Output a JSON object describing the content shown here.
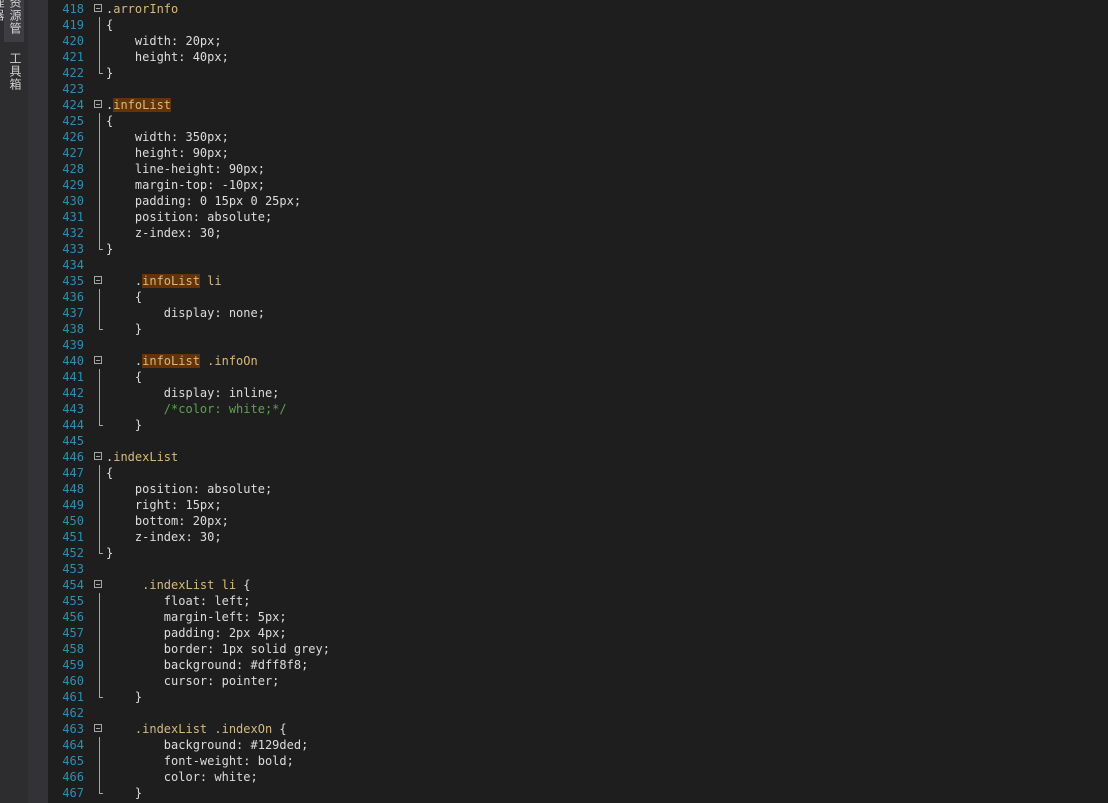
{
  "side_tabs": [
    "资源管理器",
    "工具箱"
  ],
  "lines": [
    {
      "n": "418",
      "fold": "start",
      "tokens": [
        {
          "t": ".",
          "c": "punc"
        },
        {
          "t": "arrorInfo",
          "c": "sel"
        }
      ]
    },
    {
      "n": "419",
      "fold": "mid",
      "tokens": [
        {
          "t": "{",
          "c": "punc"
        }
      ]
    },
    {
      "n": "420",
      "fold": "mid",
      "tokens": [
        {
          "t": "    width",
          "c": "prop"
        },
        {
          "t": ": 20px;",
          "c": "val"
        }
      ]
    },
    {
      "n": "421",
      "fold": "mid",
      "tokens": [
        {
          "t": "    height",
          "c": "prop"
        },
        {
          "t": ": 40px;",
          "c": "val"
        }
      ]
    },
    {
      "n": "422",
      "fold": "end",
      "tokens": [
        {
          "t": "}",
          "c": "punc"
        }
      ]
    },
    {
      "n": "423",
      "fold": "none",
      "tokens": []
    },
    {
      "n": "424",
      "fold": "start",
      "tokens": [
        {
          "t": ".",
          "c": "punc"
        },
        {
          "t": "infoList",
          "c": "sel-hl"
        }
      ]
    },
    {
      "n": "425",
      "fold": "mid",
      "tokens": [
        {
          "t": "{",
          "c": "punc"
        }
      ]
    },
    {
      "n": "426",
      "fold": "mid",
      "tokens": [
        {
          "t": "    width",
          "c": "prop"
        },
        {
          "t": ": 350px;",
          "c": "val"
        }
      ]
    },
    {
      "n": "427",
      "fold": "mid",
      "tokens": [
        {
          "t": "    height",
          "c": "prop"
        },
        {
          "t": ": 90px;",
          "c": "val"
        }
      ]
    },
    {
      "n": "428",
      "fold": "mid",
      "tokens": [
        {
          "t": "    line-height",
          "c": "prop"
        },
        {
          "t": ": 90px;",
          "c": "val"
        }
      ]
    },
    {
      "n": "429",
      "fold": "mid",
      "tokens": [
        {
          "t": "    margin-top",
          "c": "prop"
        },
        {
          "t": ": -10px;",
          "c": "val"
        }
      ]
    },
    {
      "n": "430",
      "fold": "mid",
      "tokens": [
        {
          "t": "    padding",
          "c": "prop"
        },
        {
          "t": ": 0 15px 0 25px;",
          "c": "val"
        }
      ]
    },
    {
      "n": "431",
      "fold": "mid",
      "tokens": [
        {
          "t": "    position",
          "c": "prop"
        },
        {
          "t": ": absolute;",
          "c": "val"
        }
      ]
    },
    {
      "n": "432",
      "fold": "mid",
      "tokens": [
        {
          "t": "    z-index",
          "c": "prop"
        },
        {
          "t": ": 30;",
          "c": "val"
        }
      ]
    },
    {
      "n": "433",
      "fold": "end",
      "tokens": [
        {
          "t": "}",
          "c": "punc"
        }
      ]
    },
    {
      "n": "434",
      "fold": "none",
      "tokens": []
    },
    {
      "n": "435",
      "fold": "start",
      "tokens": [
        {
          "t": "    .",
          "c": "punc"
        },
        {
          "t": "infoList",
          "c": "sel-hl"
        },
        {
          "t": " li",
          "c": "sel"
        }
      ]
    },
    {
      "n": "436",
      "fold": "mid",
      "tokens": [
        {
          "t": "    {",
          "c": "punc"
        }
      ]
    },
    {
      "n": "437",
      "fold": "mid",
      "tokens": [
        {
          "t": "        display",
          "c": "prop"
        },
        {
          "t": ": none;",
          "c": "val"
        }
      ]
    },
    {
      "n": "438",
      "fold": "end",
      "tokens": [
        {
          "t": "    }",
          "c": "punc"
        }
      ]
    },
    {
      "n": "439",
      "fold": "none",
      "tokens": []
    },
    {
      "n": "440",
      "fold": "start",
      "tokens": [
        {
          "t": "    .",
          "c": "punc"
        },
        {
          "t": "infoList",
          "c": "sel-hl"
        },
        {
          "t": " .infoOn",
          "c": "sel"
        }
      ]
    },
    {
      "n": "441",
      "fold": "mid",
      "tokens": [
        {
          "t": "    {",
          "c": "punc"
        }
      ]
    },
    {
      "n": "442",
      "fold": "mid",
      "tokens": [
        {
          "t": "        display",
          "c": "prop"
        },
        {
          "t": ": inline;",
          "c": "val"
        }
      ]
    },
    {
      "n": "443",
      "fold": "mid",
      "tokens": [
        {
          "t": "        /*color: white;*/",
          "c": "com"
        }
      ]
    },
    {
      "n": "444",
      "fold": "end",
      "tokens": [
        {
          "t": "    }",
          "c": "punc"
        }
      ]
    },
    {
      "n": "445",
      "fold": "none",
      "tokens": []
    },
    {
      "n": "446",
      "fold": "start",
      "tokens": [
        {
          "t": ".",
          "c": "punc"
        },
        {
          "t": "indexList",
          "c": "sel"
        }
      ]
    },
    {
      "n": "447",
      "fold": "mid",
      "tokens": [
        {
          "t": "{",
          "c": "punc"
        }
      ]
    },
    {
      "n": "448",
      "fold": "mid",
      "tokens": [
        {
          "t": "    position",
          "c": "prop"
        },
        {
          "t": ": absolute;",
          "c": "val"
        }
      ]
    },
    {
      "n": "449",
      "fold": "mid",
      "tokens": [
        {
          "t": "    right",
          "c": "prop"
        },
        {
          "t": ": 15px;",
          "c": "val"
        }
      ]
    },
    {
      "n": "450",
      "fold": "mid",
      "tokens": [
        {
          "t": "    bottom",
          "c": "prop"
        },
        {
          "t": ": 20px;",
          "c": "val"
        }
      ]
    },
    {
      "n": "451",
      "fold": "mid",
      "tokens": [
        {
          "t": "    z-index",
          "c": "prop"
        },
        {
          "t": ": 30;",
          "c": "val"
        }
      ]
    },
    {
      "n": "452",
      "fold": "end",
      "tokens": [
        {
          "t": "}",
          "c": "punc"
        }
      ]
    },
    {
      "n": "453",
      "fold": "none",
      "tokens": []
    },
    {
      "n": "454",
      "fold": "start",
      "tokens": [
        {
          "t": "     .indexList li",
          "c": "sel"
        },
        {
          "t": " {",
          "c": "punc"
        }
      ]
    },
    {
      "n": "455",
      "fold": "mid",
      "tokens": [
        {
          "t": "        float",
          "c": "prop"
        },
        {
          "t": ": left;",
          "c": "val"
        }
      ]
    },
    {
      "n": "456",
      "fold": "mid",
      "tokens": [
        {
          "t": "        margin-left",
          "c": "prop"
        },
        {
          "t": ": 5px;",
          "c": "val"
        }
      ]
    },
    {
      "n": "457",
      "fold": "mid",
      "tokens": [
        {
          "t": "        padding",
          "c": "prop"
        },
        {
          "t": ": 2px 4px;",
          "c": "val"
        }
      ]
    },
    {
      "n": "458",
      "fold": "mid",
      "tokens": [
        {
          "t": "        border",
          "c": "prop"
        },
        {
          "t": ": 1px solid grey;",
          "c": "val"
        }
      ]
    },
    {
      "n": "459",
      "fold": "mid",
      "tokens": [
        {
          "t": "        background",
          "c": "prop"
        },
        {
          "t": ": #dff8f8;",
          "c": "val"
        }
      ]
    },
    {
      "n": "460",
      "fold": "mid",
      "tokens": [
        {
          "t": "        cursor",
          "c": "prop"
        },
        {
          "t": ": pointer;",
          "c": "val"
        }
      ]
    },
    {
      "n": "461",
      "fold": "end",
      "tokens": [
        {
          "t": "    }",
          "c": "punc"
        }
      ]
    },
    {
      "n": "462",
      "fold": "none",
      "tokens": []
    },
    {
      "n": "463",
      "fold": "start",
      "tokens": [
        {
          "t": "    .indexList .indexOn",
          "c": "sel"
        },
        {
          "t": " {",
          "c": "punc"
        }
      ]
    },
    {
      "n": "464",
      "fold": "mid",
      "tokens": [
        {
          "t": "        background",
          "c": "prop"
        },
        {
          "t": ": #129ded;",
          "c": "val"
        }
      ]
    },
    {
      "n": "465",
      "fold": "mid",
      "tokens": [
        {
          "t": "        font-weight",
          "c": "prop"
        },
        {
          "t": ": bold;",
          "c": "val"
        }
      ]
    },
    {
      "n": "466",
      "fold": "mid",
      "tokens": [
        {
          "t": "        color",
          "c": "prop"
        },
        {
          "t": ": white;",
          "c": "val"
        }
      ]
    },
    {
      "n": "467",
      "fold": "end",
      "tokens": [
        {
          "t": "    }",
          "c": "punc"
        }
      ]
    }
  ]
}
